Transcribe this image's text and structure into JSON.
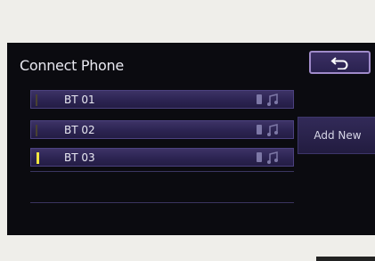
{
  "screen": {
    "title": "Connect Phone",
    "back_icon": "return-arrow-icon",
    "devices": [
      {
        "label": "BT 01",
        "selected": false,
        "icons": [
          "phone-icon",
          "music-note-icon"
        ]
      },
      {
        "label": "BT 02",
        "selected": false,
        "icons": [
          "phone-icon",
          "music-note-icon"
        ]
      },
      {
        "label": "BT 03",
        "selected": true,
        "icons": [
          "phone-icon",
          "music-note-icon"
        ]
      }
    ],
    "add_new_label": "Add New"
  },
  "colors": {
    "background": "#0b0b10",
    "row": "#2c2452",
    "accent_selected": "#f2e640",
    "button_border": "#9f8ac9"
  }
}
